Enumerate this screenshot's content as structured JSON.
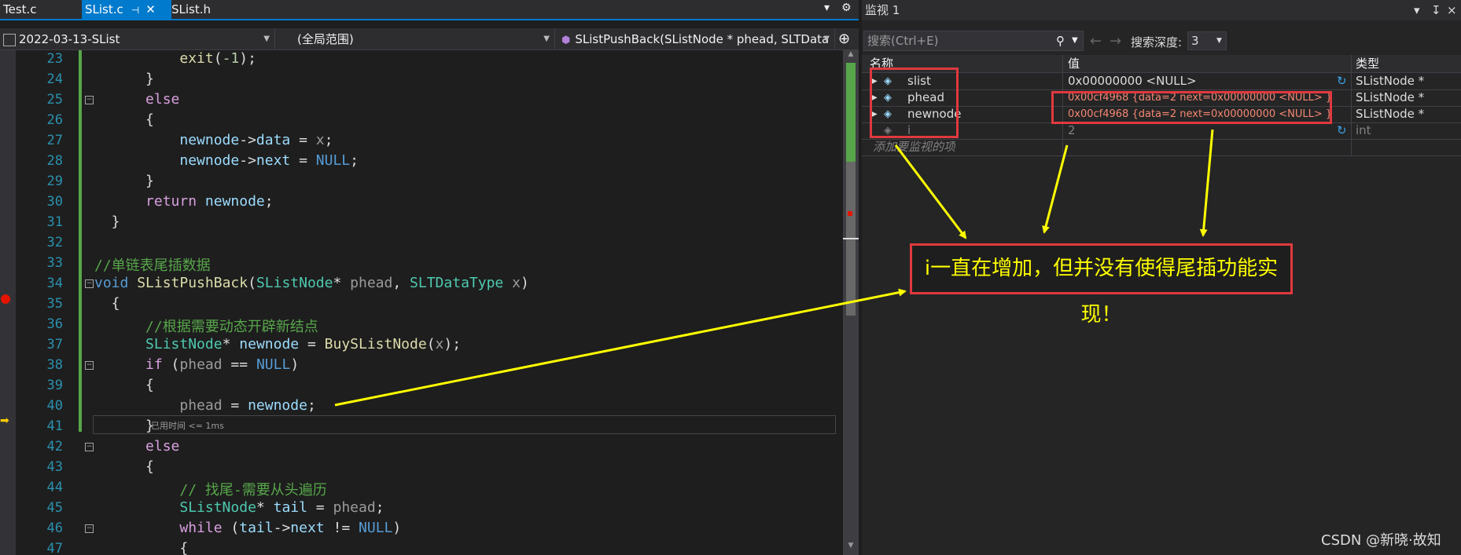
{
  "tabs": [
    {
      "label": "Test.c"
    },
    {
      "label": "SList.c"
    },
    {
      "label": "SList.h"
    }
  ],
  "tab_controls": {
    "dropdown": "▾",
    "settings": "⚙"
  },
  "navbar": {
    "project": "2022-03-13-SList",
    "scope": "(全局范围)",
    "function": "SListPushBack(SListNode * phead, SLTData",
    "split": "⊕"
  },
  "code": {
    "line_numbers": [
      "23",
      "24",
      "25",
      "26",
      "27",
      "28",
      "29",
      "30",
      "31",
      "32",
      "33",
      "34",
      "35",
      "36",
      "37",
      "38",
      "39",
      "40",
      "41",
      "42",
      "43",
      "44",
      "45",
      "46",
      "47"
    ],
    "elapsed_hint": "已用时间 <= 1ms"
  },
  "watch": {
    "title": "监视 1",
    "title_controls": {
      "dropdown": "▾",
      "pin": "↧",
      "close": "×"
    },
    "search_placeholder": "搜索(Ctrl+E)",
    "search_depth_label": "搜索深度:",
    "search_depth_value": "3",
    "columns": {
      "name": "名称",
      "value": "值",
      "type": "类型"
    },
    "rows": [
      {
        "name": "slist",
        "value": "0x00000000 <NULL>",
        "type": "SListNode *"
      },
      {
        "name": "phead",
        "value": "0x00cf4968 {data=2 next=0x00000000 <NULL> }",
        "type": "SListNode *"
      },
      {
        "name": "newnode",
        "value": "0x00cf4968 {data=2 next=0x00000000 <NULL> }",
        "type": "SListNode *"
      },
      {
        "name": "i",
        "value": "2",
        "type": "int"
      }
    ],
    "add_item_hint": "添加要监视的项"
  },
  "annotation": {
    "text": "i一直在增加，但并没有使得尾插功能实现！"
  },
  "watermark": "CSDN @新晓·故知",
  "colors": {
    "accent": "#007acc",
    "annotation_red": "#e0393e",
    "annotation_yellow": "#ffff00",
    "changed_value": "#f48771"
  }
}
